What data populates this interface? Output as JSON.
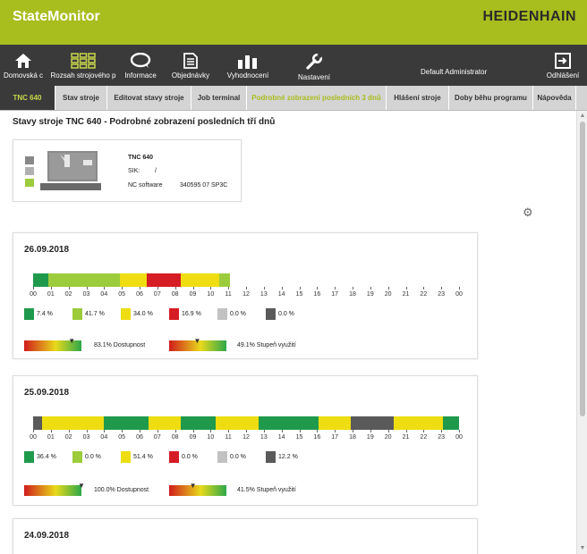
{
  "app": {
    "title": "StateMonitor",
    "brand": "HEIDENHAIN"
  },
  "nav": [
    {
      "label": "Domovská c",
      "icon": "home-icon"
    },
    {
      "label": "Rozsah strojového p",
      "icon": "grid-icon"
    },
    {
      "label": "Informace",
      "icon": "chat-bubble-icon"
    },
    {
      "label": "Objednávky",
      "icon": "document-icon"
    },
    {
      "label": "Vyhodnocení",
      "icon": "bar-chart-icon"
    },
    {
      "label": "Nastavení",
      "icon": "wrench-icon"
    },
    {
      "label": "Odhlášení",
      "icon": "logout-icon"
    }
  ],
  "user": {
    "name": "Default Administrator"
  },
  "tabs": [
    {
      "label": "TNC 640"
    },
    {
      "label": "Stav stroje"
    },
    {
      "label": "Editovat stavy stroje"
    },
    {
      "label": "Job terminal"
    },
    {
      "label": "Podrobné zobrazení posledních 3 dnů"
    },
    {
      "label": "Hlášení stroje"
    },
    {
      "label": "Doby běhu programu"
    },
    {
      "label": "Nápověda"
    }
  ],
  "page": {
    "title": "Stavy stroje TNC 640 - Podrobné zobrazení posledních tří dnů"
  },
  "machine": {
    "name": "TNC 640",
    "sik_label": "SIK:",
    "sik_value": "/",
    "software_label": "NC software",
    "software_value": "340595 07 SP3C",
    "status_colors": [
      "#888888",
      "#b0b0b0",
      "#9ccc3c"
    ]
  },
  "state_colors": {
    "green": "#1f9a4c",
    "lightgreen": "#9ccc3c",
    "yellow": "#eedd11",
    "red": "#d61c24",
    "lightgray": "#c2c2c2",
    "darkgray": "#5a5a5a"
  },
  "hours": [
    "00",
    "01",
    "02",
    "03",
    "04",
    "05",
    "06",
    "07",
    "08",
    "09",
    "10",
    "11",
    "12",
    "13",
    "14",
    "15",
    "16",
    "17",
    "18",
    "19",
    "20",
    "21",
    "22",
    "23",
    "00"
  ],
  "days": [
    {
      "date": "26.09.2018",
      "segments": [
        {
          "start": 0,
          "end": 0.85,
          "state": "green"
        },
        {
          "start": 0.85,
          "end": 4.9,
          "state": "lightgreen"
        },
        {
          "start": 4.9,
          "end": 6.4,
          "state": "yellow"
        },
        {
          "start": 6.4,
          "end": 8.3,
          "state": "red"
        },
        {
          "start": 8.3,
          "end": 10.5,
          "state": "yellow"
        },
        {
          "start": 10.5,
          "end": 11.1,
          "state": "lightgreen"
        }
      ],
      "legend": [
        {
          "state": "green",
          "value": "7.4 %"
        },
        {
          "state": "lightgreen",
          "value": "41.7 %"
        },
        {
          "state": "yellow",
          "value": "34.0 %"
        },
        {
          "state": "red",
          "value": "16.9 %"
        },
        {
          "state": "lightgray",
          "value": "0.0 %"
        },
        {
          "state": "darkgray",
          "value": "0.0 %"
        }
      ],
      "availability": {
        "value": 0.831,
        "text": "83.1% Dostupnost"
      },
      "utilization": {
        "value": 0.491,
        "text": "49.1% Stupeň využití"
      }
    },
    {
      "date": "25.09.2018",
      "segments": [
        {
          "start": 0,
          "end": 0.5,
          "state": "darkgray"
        },
        {
          "start": 0.5,
          "end": 4.0,
          "state": "yellow"
        },
        {
          "start": 4.0,
          "end": 6.5,
          "state": "green"
        },
        {
          "start": 6.5,
          "end": 8.3,
          "state": "yellow"
        },
        {
          "start": 8.3,
          "end": 10.3,
          "state": "green"
        },
        {
          "start": 10.3,
          "end": 12.7,
          "state": "yellow"
        },
        {
          "start": 12.7,
          "end": 16.1,
          "state": "green"
        },
        {
          "start": 16.1,
          "end": 17.9,
          "state": "yellow"
        },
        {
          "start": 17.9,
          "end": 20.3,
          "state": "darkgray"
        },
        {
          "start": 20.3,
          "end": 23.1,
          "state": "yellow"
        },
        {
          "start": 23.1,
          "end": 24,
          "state": "green"
        }
      ],
      "legend": [
        {
          "state": "green",
          "value": "36.4 %"
        },
        {
          "state": "lightgreen",
          "value": "0.0 %"
        },
        {
          "state": "yellow",
          "value": "51.4 %"
        },
        {
          "state": "red",
          "value": "0.0 %"
        },
        {
          "state": "lightgray",
          "value": "0.0 %"
        },
        {
          "state": "darkgray",
          "value": "12.2 %"
        }
      ],
      "availability": {
        "value": 1.0,
        "text": "100.0% Dostupnost"
      },
      "utilization": {
        "value": 0.415,
        "text": "41.5% Stupeň využití"
      }
    },
    {
      "date": "24.09.2018",
      "segments": [],
      "legend": [],
      "availability": null,
      "utilization": null
    }
  ]
}
